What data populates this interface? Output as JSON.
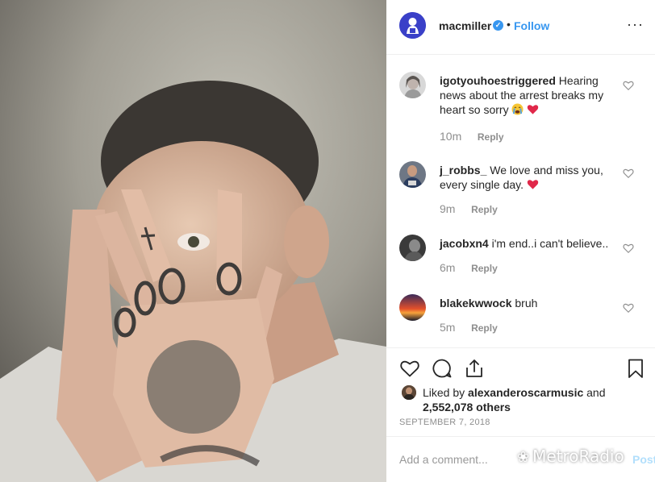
{
  "post": {
    "username": "macmiller",
    "separator": "•",
    "follow_label": "Follow",
    "more_label": "···",
    "verified_mark": "✓"
  },
  "comments": [
    {
      "user": "igotyouhoestriggered",
      "text": "Hearing news about the arrest breaks my heart so sorry",
      "time": "10m",
      "reply": "Reply"
    },
    {
      "user": "j_robbs_",
      "text": "We love and miss you, every single day.",
      "time": "9m",
      "reply": "Reply"
    },
    {
      "user": "jacobxn4",
      "text": "i'm end..i can't believe..",
      "time": "6m",
      "reply": "Reply"
    },
    {
      "user": "blakekwwock",
      "text": "bruh",
      "time": "5m",
      "reply": "Reply"
    }
  ],
  "likes": {
    "prefix": "Liked by",
    "user": "alexanderoscarmusic",
    "and": "and",
    "count": "2,552,078 others"
  },
  "date": "SEPTEMBER 7, 2018",
  "add_comment": {
    "placeholder": "Add a comment...",
    "post_label": "Post"
  },
  "watermark": {
    "text": "MetroRadio",
    "icon": "wechat-icon"
  },
  "colors": {
    "accent": "#3897f0",
    "heart_red": "#ed4956",
    "secondary_text": "#8e8e8e",
    "avatar_bg": "#3a40c8"
  }
}
